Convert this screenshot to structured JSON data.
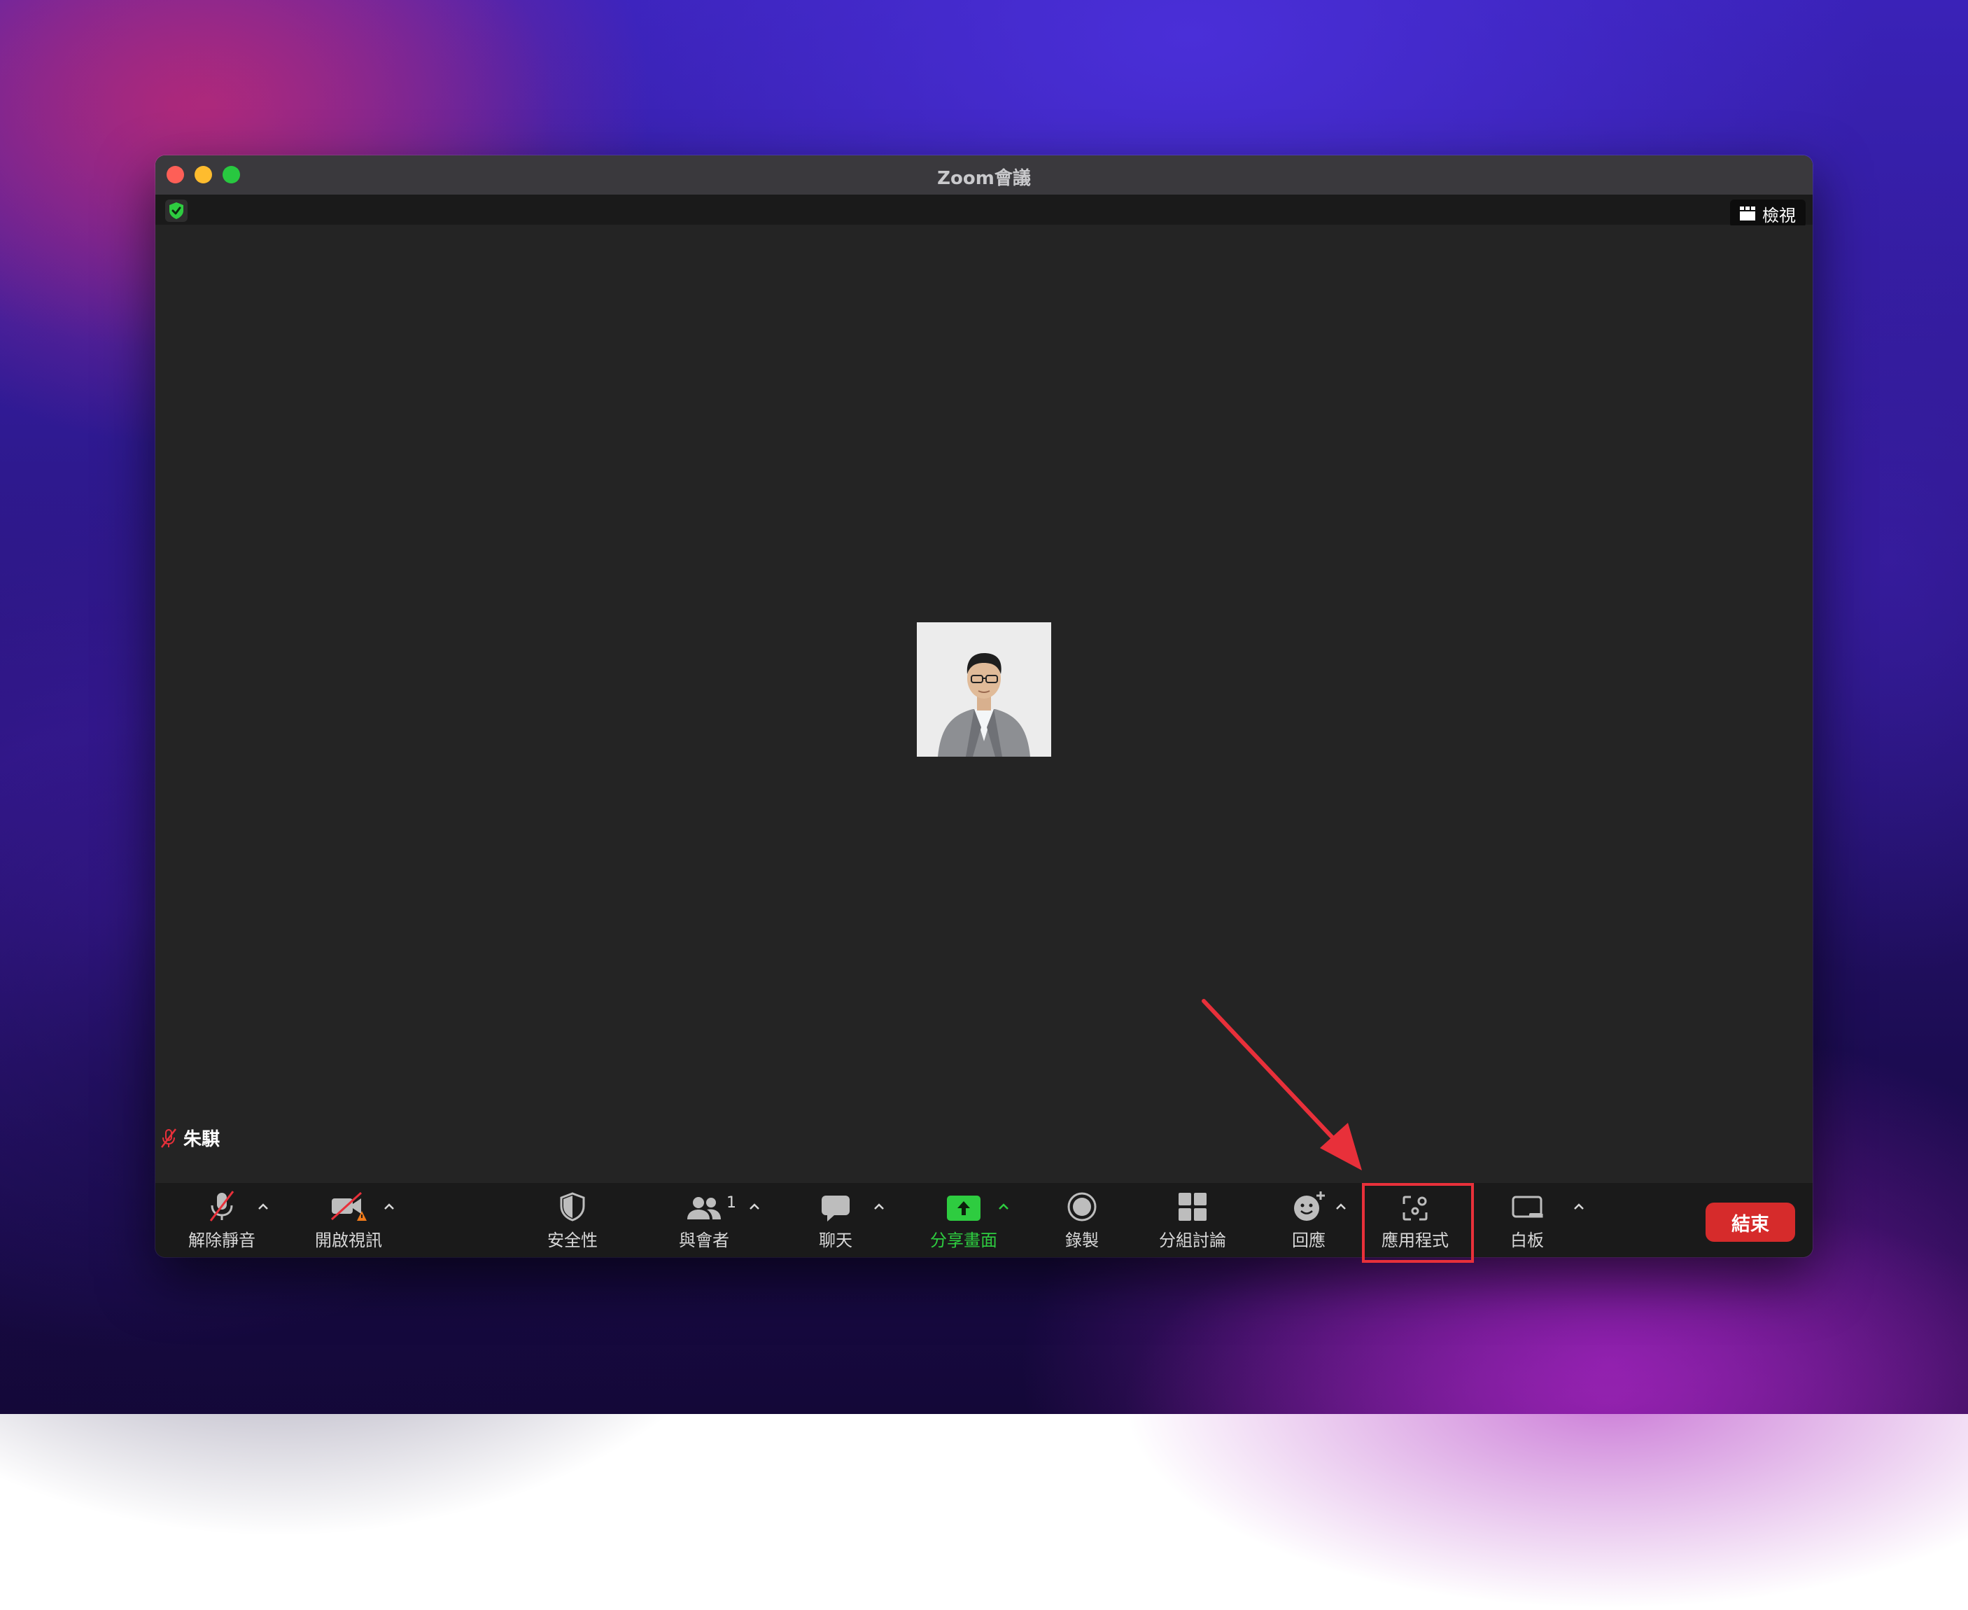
{
  "window": {
    "title": "Zoom會議"
  },
  "topbar": {
    "view_label": "檢視"
  },
  "participant": {
    "name": "朱騏"
  },
  "toolbar": {
    "unmute_label": "解除靜音",
    "start_video_label": "開啟視訊",
    "security_label": "安全性",
    "participants_label": "與會者",
    "participants_count": "1",
    "chat_label": "聊天",
    "share_label": "分享畫面",
    "record_label": "錄製",
    "breakout_label": "分組討論",
    "reactions_label": "回應",
    "apps_label": "應用程式",
    "whiteboard_label": "白板",
    "end_label": "結束"
  },
  "colors": {
    "share_accent": "#2ecc40",
    "end_button": "#d62b2b",
    "annotation": "#e8303a",
    "security_shield": "#2ecc40"
  },
  "icons": [
    "shield-check-icon",
    "grid-view-icon",
    "mic-muted-icon",
    "video-off-icon",
    "warning-icon",
    "security-shield-icon",
    "participants-icon",
    "chat-bubble-icon",
    "share-screen-icon",
    "record-icon",
    "breakout-rooms-icon",
    "reactions-icon",
    "apps-icon",
    "whiteboard-icon",
    "caret-up-icon"
  ]
}
